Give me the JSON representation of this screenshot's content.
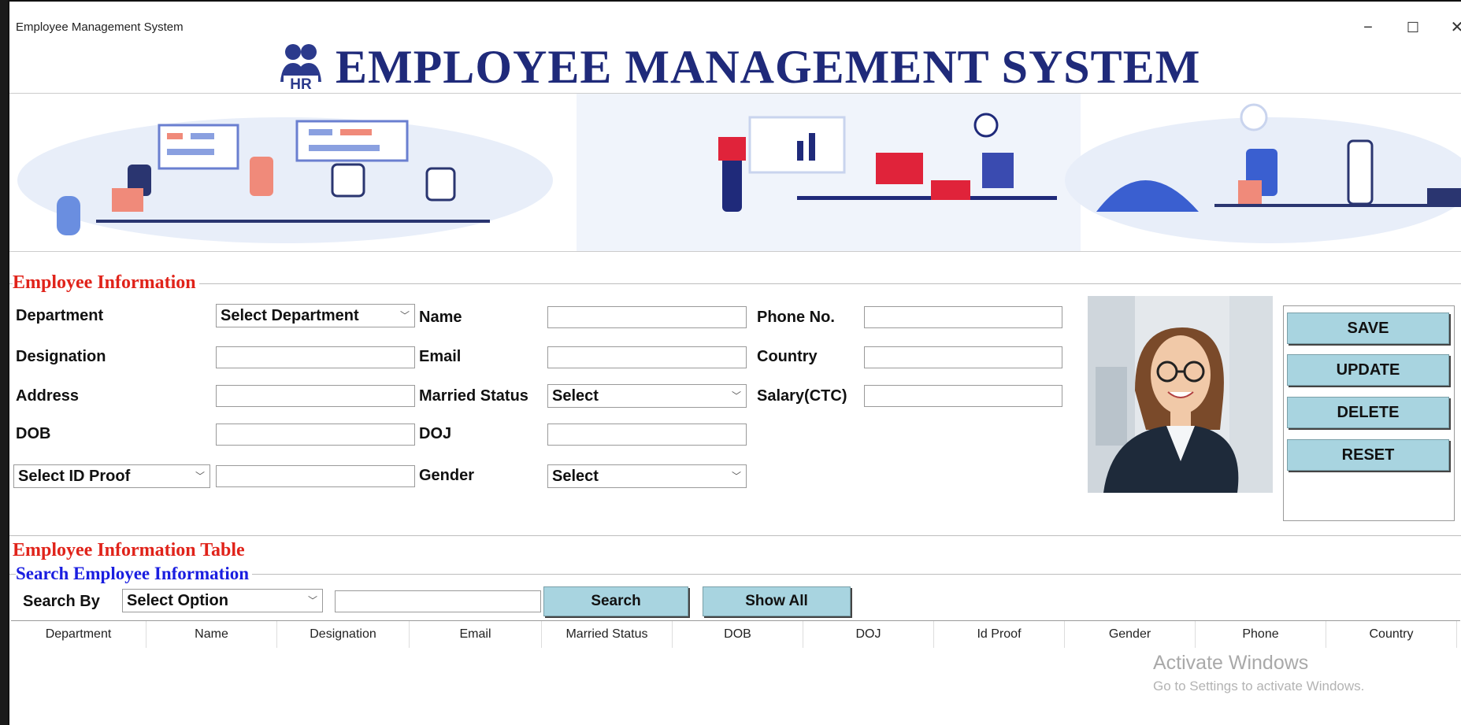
{
  "window": {
    "title": "Employee Management System",
    "controls": [
      "−",
      "☐",
      "✕"
    ]
  },
  "header": {
    "title": "EMPLOYEE MANAGEMENT SYSTEM",
    "logo_text": "HR",
    "logo_icon": "hr-people-icon"
  },
  "employee_info": {
    "group_label": "Employee Information",
    "department_label": "Department",
    "department_value": "Select Department",
    "designation_label": "Designation",
    "address_label": "Address",
    "dob_label": "DOB",
    "id_proof_value": "Select ID Proof",
    "name_label": "Name",
    "email_label": "Email",
    "married_status_label": "Married Status",
    "married_status_value": "Select",
    "doj_label": "DOJ",
    "gender_label": "Gender",
    "gender_value": "Select",
    "phone_label": "Phone No.",
    "country_label": "Country",
    "salary_label": "Salary(CTC)"
  },
  "actions": {
    "save": "SAVE",
    "update": "UPDATE",
    "delete": "DELETE",
    "reset": "RESET"
  },
  "table_section": {
    "group_label": "Employee Information Table",
    "search_group_label": "Search Employee Information",
    "search_by_label": "Search By",
    "search_by_value": "Select Option",
    "search_button": "Search",
    "show_all_button": "Show All",
    "columns": [
      "Department",
      "Name",
      "Designation",
      "Email",
      "Married Status",
      "DOB",
      "DOJ",
      "Id Proof",
      "Gender",
      "Phone",
      "Country"
    ]
  },
  "watermark": {
    "line1": "Activate Windows",
    "line2": "Go to Settings to activate Windows."
  },
  "colors": {
    "section_red": "#e0231a",
    "section_blue": "#1a1ee0",
    "title_navy": "#1f2a7a",
    "button_bg": "#a8d4e0"
  }
}
